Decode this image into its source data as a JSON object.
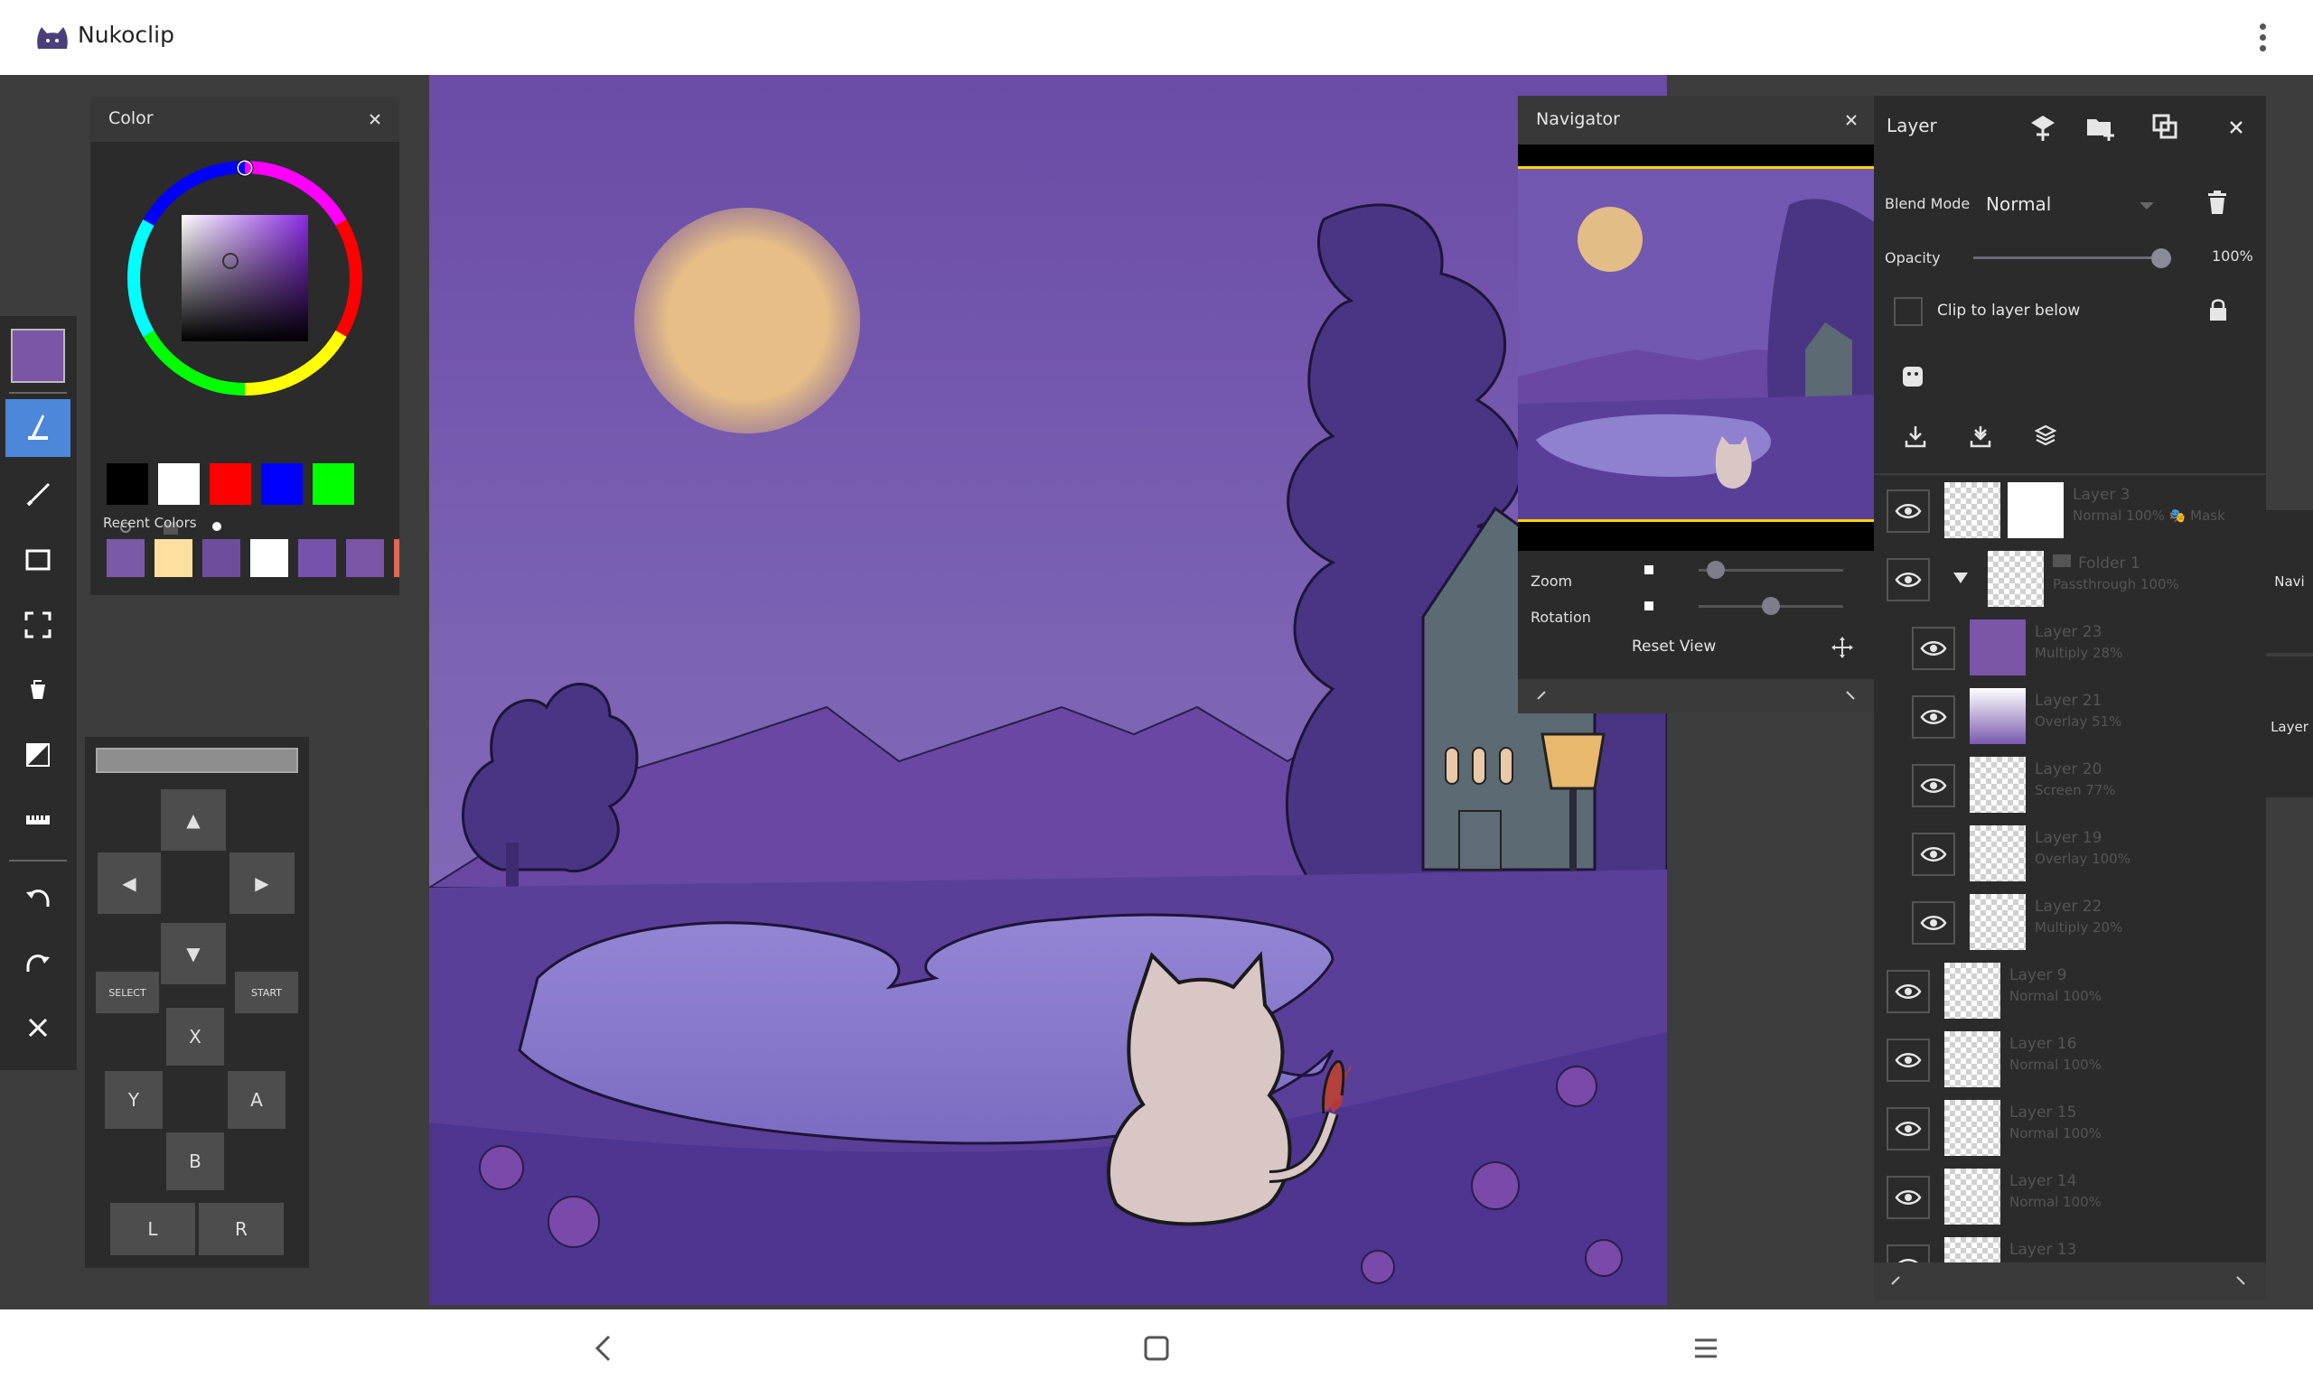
{
  "app": {
    "title": "Nukoclip"
  },
  "colors": {
    "current": "#7a55a8",
    "accent": "#4c87d9",
    "basic_swatches": [
      "#000000",
      "#ffffff",
      "#ff0000",
      "#0000ff",
      "#00ff00"
    ],
    "recent_swatches": [
      "#7a5aa8",
      "#fde0a0",
      "#6e4d9e",
      "#ffffff",
      "#7752ad",
      "#7a55a8",
      "#e06a55"
    ]
  },
  "color_panel": {
    "title": "Color",
    "recent_label": "Recent Colors"
  },
  "toolbar": {
    "tools": [
      "brush-icon",
      "pen-icon",
      "rectangle-icon",
      "selection-icon",
      "fill-icon",
      "gradient-icon",
      "ruler-icon",
      "undo-icon",
      "redo-icon",
      "close-icon"
    ]
  },
  "gamepad": {
    "up": "▲",
    "down": "▼",
    "left": "◀",
    "right": "▶",
    "select": "SELECT",
    "start": "START",
    "x": "X",
    "y": "Y",
    "a": "A",
    "b": "B",
    "l": "L",
    "r": "R"
  },
  "navigator": {
    "title": "Navigator",
    "zoom_label": "Zoom",
    "zoom_level": 0.12,
    "rotation_label": "Rotation",
    "rotation_level": 0.5,
    "reset_label": "Reset View"
  },
  "layer_panel": {
    "title": "Layer",
    "blend_label": "Blend Mode",
    "blend_value": "Normal",
    "opacity_label": "Opacity",
    "opacity_value": "100%",
    "opacity_level": 1.0,
    "clip_label": "Clip to layer below",
    "layers": [
      {
        "name": "Layer 3",
        "mode": "Normal 100% 🎭 Mask"
      },
      {
        "name": "Folder 1",
        "mode": "Passthrough 100%"
      },
      {
        "name": "Layer 23",
        "mode": "Multiply 28%"
      },
      {
        "name": "Layer 21",
        "mode": "Overlay 51%"
      },
      {
        "name": "Layer 20",
        "mode": "Screen 77%"
      },
      {
        "name": "Layer 19",
        "mode": "Overlay 100%"
      },
      {
        "name": "Layer 22",
        "mode": "Multiply 20%"
      },
      {
        "name": "Layer 9",
        "mode": "Normal 100%"
      },
      {
        "name": "Layer 16",
        "mode": "Normal 100%"
      },
      {
        "name": "Layer 15",
        "mode": "Normal 100%"
      },
      {
        "name": "Layer 14",
        "mode": "Normal 100%"
      },
      {
        "name": "Layer 13",
        "mode": ""
      }
    ]
  },
  "side_tabs": {
    "navi": "Navi",
    "layer": "Layer"
  }
}
